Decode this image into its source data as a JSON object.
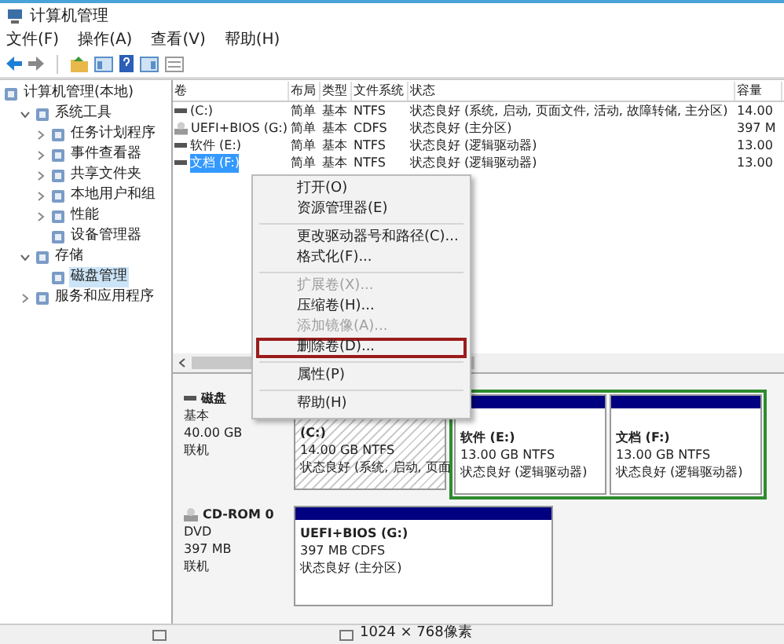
{
  "window": {
    "title": "计算机管理"
  },
  "menu": [
    "文件(F)",
    "操作(A)",
    "查看(V)",
    "帮助(H)"
  ],
  "tree": [
    {
      "label": "计算机管理(本地)",
      "selected": false,
      "children": [
        {
          "label": "系统工具",
          "expanded": true,
          "selected": false,
          "children": [
            {
              "label": "任务计划程序",
              "expanded": false,
              "selected": false
            },
            {
              "label": "事件查看器",
              "expanded": false,
              "selected": false
            },
            {
              "label": "共享文件夹",
              "expanded": false,
              "selected": false
            },
            {
              "label": "本地用户和组",
              "expanded": false,
              "selected": false
            },
            {
              "label": "性能",
              "expanded": false,
              "selected": false
            },
            {
              "label": "设备管理器",
              "selected": false
            }
          ]
        },
        {
          "label": "存储",
          "expanded": true,
          "selected": false,
          "children": [
            {
              "label": "磁盘管理",
              "selected": true
            }
          ]
        },
        {
          "label": "服务和应用程序",
          "expanded": false,
          "selected": false
        }
      ]
    }
  ],
  "table": {
    "columns": [
      "卷",
      "布局",
      "类型",
      "文件系统",
      "状态",
      "容量"
    ],
    "rows": [
      {
        "kind": "disk",
        "selected": false,
        "cells": [
          "(C:)",
          "简单",
          "基本",
          "NTFS",
          "状态良好 (系统, 启动, 页面文件, 活动, 故障转储, 主分区)",
          "14.00"
        ]
      },
      {
        "kind": "cd",
        "selected": false,
        "cells": [
          "UEFI+BIOS (G:)",
          "简单",
          "基本",
          "CDFS",
          "状态良好 (主分区)",
          "397 M"
        ]
      },
      {
        "kind": "disk",
        "selected": false,
        "cells": [
          "软件 (E:)",
          "简单",
          "基本",
          "NTFS",
          "状态良好 (逻辑驱动器)",
          "13.00"
        ]
      },
      {
        "kind": "disk",
        "selected": true,
        "cells": [
          "文档 (F:)",
          "简单",
          "基本",
          "NTFS",
          "状态良好 (逻辑驱动器)",
          "13.00"
        ]
      }
    ]
  },
  "disks": [
    {
      "kind": "disk",
      "name": "磁盘",
      "type": "基本",
      "size": "40.00 GB",
      "state": "联机",
      "partitions": [
        {
          "kind": "primary",
          "selected": true,
          "label": "(C:)",
          "size": "14.00 GB NTFS",
          "status": "状态良好 (系统, 启动, 页面"
        },
        {
          "kind": "logical",
          "selected": false,
          "label": "软件 (E:)",
          "size": "13.00 GB NTFS",
          "status": "状态良好 (逻辑驱动器)"
        },
        {
          "kind": "logical",
          "selected": false,
          "label": "文档 (F:)",
          "size": "13.00 GB NTFS",
          "status": "状态良好 (逻辑驱动器)"
        }
      ]
    },
    {
      "kind": "cd",
      "name": "CD-ROM 0",
      "type": "DVD",
      "size": "397 MB",
      "state": "联机",
      "partitions": [
        {
          "kind": "primary",
          "selected": false,
          "label": "UEFI+BIOS (G:)",
          "size": "397 MB CDFS",
          "status": "状态良好 (主分区)"
        }
      ]
    }
  ],
  "context_menu": [
    {
      "kind": "item",
      "label": "打开(O)",
      "disabled": false,
      "selected": false
    },
    {
      "kind": "item",
      "label": "资源管理器(E)",
      "disabled": false,
      "selected": false
    },
    {
      "kind": "separator"
    },
    {
      "kind": "item",
      "label": "更改驱动器号和路径(C)...",
      "disabled": false,
      "selected": false
    },
    {
      "kind": "item",
      "label": "格式化(F)...",
      "disabled": false,
      "selected": false
    },
    {
      "kind": "separator"
    },
    {
      "kind": "item",
      "label": "扩展卷(X)...",
      "disabled": true,
      "selected": false
    },
    {
      "kind": "item",
      "label": "压缩卷(H)...",
      "disabled": false,
      "selected": false
    },
    {
      "kind": "item",
      "label": "添加镜像(A)...",
      "disabled": true,
      "selected": false
    },
    {
      "kind": "item",
      "label": "删除卷(D)...",
      "disabled": false,
      "selected": true
    },
    {
      "kind": "separator"
    },
    {
      "kind": "item",
      "label": "属性(P)",
      "disabled": false,
      "selected": false
    },
    {
      "kind": "separator"
    },
    {
      "kind": "item",
      "label": "帮助(H)",
      "disabled": false,
      "selected": false
    }
  ],
  "status_bar": {
    "resolution": "1024 × 768像素"
  }
}
